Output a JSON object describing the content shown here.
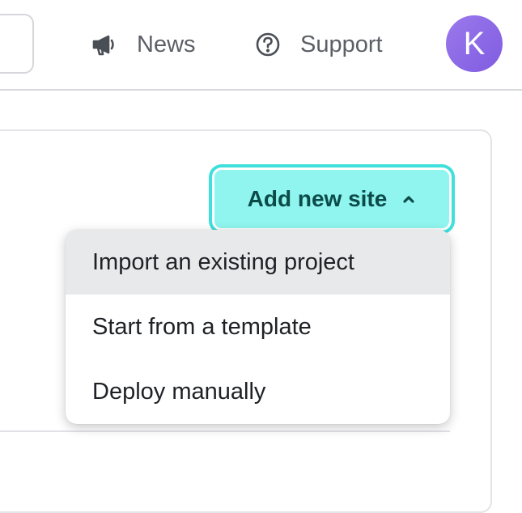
{
  "header": {
    "nav": [
      {
        "label": "News",
        "icon": "megaphone-icon"
      },
      {
        "label": "Support",
        "icon": "help-circle-icon"
      }
    ],
    "avatar_initial": "K",
    "avatar_color": "#8b68e6"
  },
  "main": {
    "add_site_button": {
      "label": "Add new site",
      "icon": "chevron-up-icon",
      "expanded": true,
      "bg_color": "#8ff5ee",
      "focus_ring_color": "#3fe0dc",
      "text_color": "#0c4b4a"
    },
    "dropdown": {
      "items": [
        {
          "label": "Import an existing project",
          "highlighted": true
        },
        {
          "label": "Start from a template",
          "highlighted": false
        },
        {
          "label": "Deploy manually",
          "highlighted": false
        }
      ]
    }
  }
}
